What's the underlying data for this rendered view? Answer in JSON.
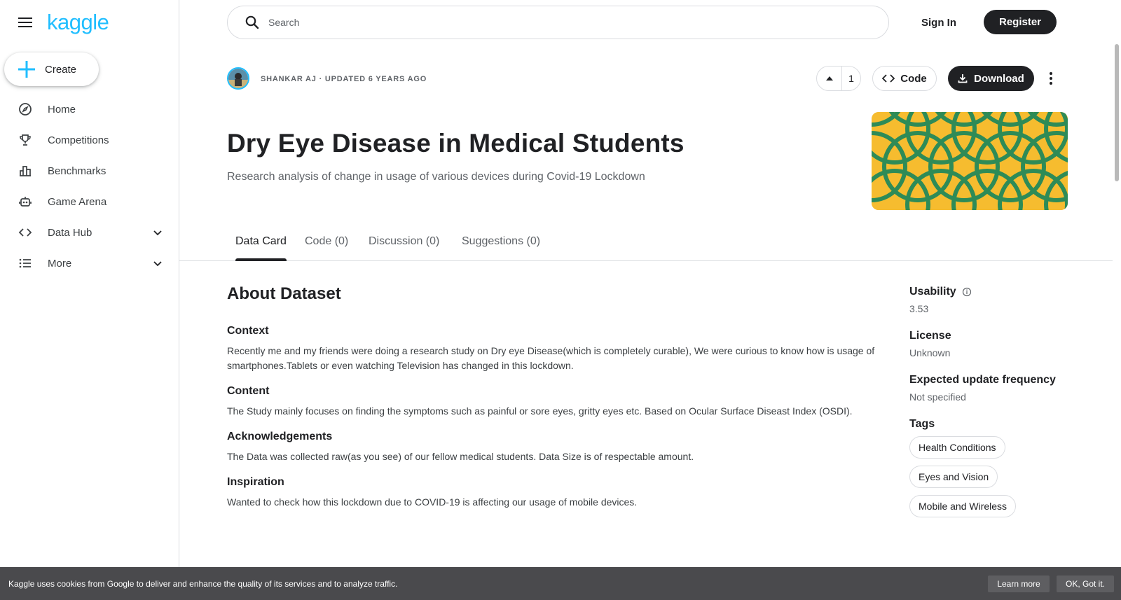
{
  "brand": {
    "logo_text": "kaggle",
    "accent": "#20beff"
  },
  "sidebar": {
    "create_label": "Create",
    "items": [
      {
        "label": "Home",
        "icon": "compass-icon"
      },
      {
        "label": "Competitions",
        "icon": "trophy-icon"
      },
      {
        "label": "Benchmarks",
        "icon": "bar-chart-icon"
      },
      {
        "label": "Game Arena",
        "icon": "robot-icon"
      },
      {
        "label": "Data Hub",
        "icon": "code-brackets-icon",
        "expandable": true
      },
      {
        "label": "More",
        "icon": "list-icon",
        "expandable": true
      }
    ]
  },
  "header": {
    "search_placeholder": "Search",
    "sign_in": "Sign In",
    "register": "Register"
  },
  "dataset": {
    "meta": "SHANKAR AJ · UPDATED 6 YEARS AGO",
    "upvotes": "1",
    "code_label": "Code",
    "download_label": "Download",
    "title": "Dry Eye Disease in Medical Students",
    "subtitle": "Research analysis of change in usage of various devices during Covid-19 Lockdown",
    "banner_colors": {
      "background": "#f6bc2f",
      "stroke": "#2e8b57"
    }
  },
  "tabs": [
    {
      "label": "Data Card",
      "active": true
    },
    {
      "label": "Code (0)",
      "active": false
    },
    {
      "label": "Discussion (0)",
      "active": false
    },
    {
      "label": "Suggestions (0)",
      "active": false
    }
  ],
  "about": {
    "heading": "About Dataset",
    "sections": [
      {
        "heading": "Context",
        "body": "Recently me and my friends were doing a research study on Dry eye Disease(which is completely curable), We were curious to know how is usage of smartphones.Tablets or even watching Television has changed in this lockdown."
      },
      {
        "heading": "Content",
        "body": "The Study mainly focuses on finding the symptoms such as painful or sore eyes, gritty eyes etc. Based on Ocular Surface Diseast Index (OSDI)."
      },
      {
        "heading": "Acknowledgements",
        "body": "The Data was collected raw(as you see) of our fellow medical students. Data Size is of respectable amount."
      },
      {
        "heading": "Inspiration",
        "body": "Wanted to check how this lockdown due to COVID-19 is affecting our usage of mobile devices."
      }
    ]
  },
  "sidepanel": {
    "usability_label": "Usability",
    "usability_value": "3.53",
    "license_label": "License",
    "license_value": "Unknown",
    "frequency_label": "Expected update frequency",
    "frequency_value": "Not specified",
    "tags_label": "Tags",
    "tags": [
      "Health Conditions",
      "Eyes and Vision",
      "Mobile and Wireless"
    ]
  },
  "cookie": {
    "message": "Kaggle uses cookies from Google to deliver and enhance the quality of its services and to analyze traffic.",
    "learn_more": "Learn more",
    "ok": "OK, Got it."
  }
}
